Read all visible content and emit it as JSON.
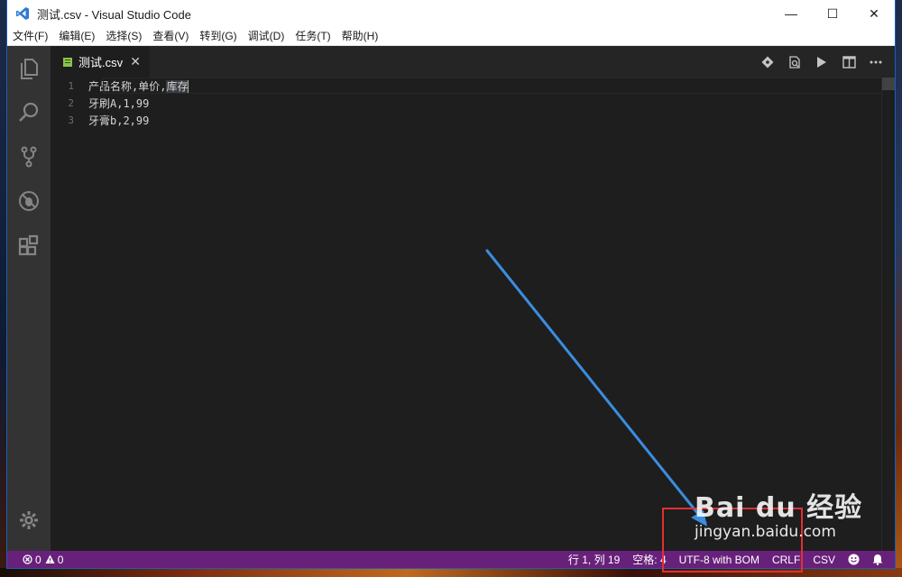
{
  "window": {
    "title": "测试.csv - Visual Studio Code",
    "controls": {
      "minimize": "—",
      "maximize": "☐",
      "close": "✕"
    }
  },
  "menu": [
    "文件(F)",
    "编辑(E)",
    "选择(S)",
    "查看(V)",
    "转到(G)",
    "调试(D)",
    "任务(T)",
    "帮助(H)"
  ],
  "activity_bar": {
    "icons": [
      "files-icon",
      "search-icon",
      "source-control-icon",
      "debug-icon",
      "extensions-icon"
    ],
    "bottom_icon": "gear-icon"
  },
  "tab": {
    "label": "测试.csv",
    "close": "✕",
    "icon": "csv-file-icon"
  },
  "editor_actions": [
    "git-compare-icon",
    "open-preview-icon",
    "run-icon",
    "split-editor-icon",
    "more-icon"
  ],
  "editor": {
    "lines": [
      {
        "number": "1",
        "before": "产品名称,单价,",
        "selected": "库存"
      },
      {
        "number": "2",
        "text": "牙刷A,1,99"
      },
      {
        "number": "3",
        "text": "牙膏b,2,99"
      }
    ]
  },
  "status_bar": {
    "errors": "0",
    "warnings": "0",
    "position": "行 1, 列 19",
    "indent": "空格: 4",
    "encoding": "UTF-8 with BOM",
    "eol": "CRLF",
    "language": "CSV",
    "color": "#68217a"
  },
  "watermark": {
    "brand": "Bai du 经验",
    "url": "jingyan.baidu.com"
  }
}
